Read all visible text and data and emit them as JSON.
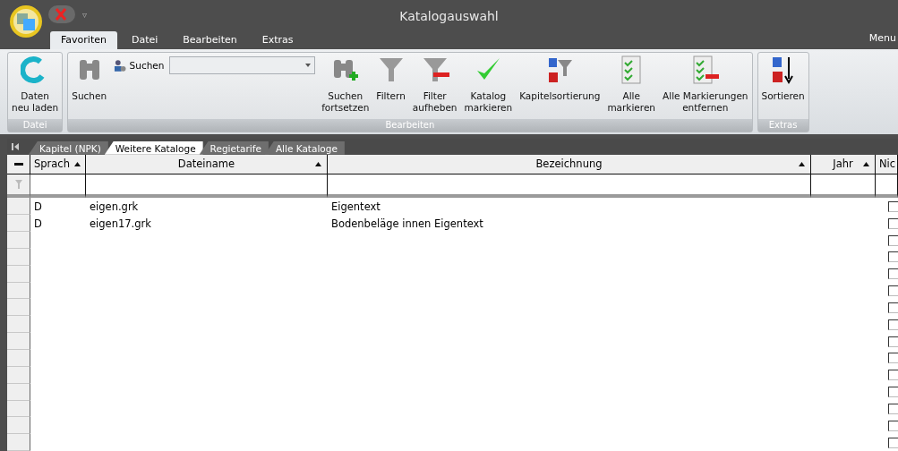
{
  "window": {
    "title": "Katalogauswahl"
  },
  "quick_access": {
    "dropdown": "▿"
  },
  "ribbon_tabs": [
    {
      "label": "Favoriten",
      "selected": true
    },
    {
      "label": "Datei",
      "selected": false
    },
    {
      "label": "Bearbeiten",
      "selected": false
    },
    {
      "label": "Extras",
      "selected": false
    }
  ],
  "menu": "Menu",
  "ribbon_groups": [
    {
      "title": "Datei",
      "items": [
        {
          "kind": "big",
          "label": "Daten\nneu laden"
        }
      ]
    },
    {
      "title": "Bearbeiten",
      "items": [
        {
          "kind": "big",
          "label": "Suchen"
        },
        {
          "kind": "search",
          "label": "Suchen"
        },
        {
          "kind": "big",
          "label": "Suchen\nfortsetzen"
        },
        {
          "kind": "big",
          "label": "Filtern"
        },
        {
          "kind": "big",
          "label": "Filter\naufheben"
        },
        {
          "kind": "big",
          "label": "Katalog\nmarkieren"
        },
        {
          "kind": "big",
          "label": "Kapitelsortierung"
        },
        {
          "kind": "big",
          "label": "Alle\nmarkieren"
        },
        {
          "kind": "big",
          "label": "Alle Markierungen\nentfernen"
        }
      ]
    },
    {
      "title": "Extras",
      "items": [
        {
          "kind": "big",
          "label": "Sortieren"
        }
      ]
    }
  ],
  "catalog_tabs": [
    {
      "label": "Kapitel (NPK)",
      "selected": false
    },
    {
      "label": "Weitere Kataloge",
      "selected": true
    },
    {
      "label": "Regietarife",
      "selected": false
    },
    {
      "label": "Alle Kataloge",
      "selected": false
    }
  ],
  "table": {
    "columns": [
      {
        "label": "Sprach",
        "sort": true
      },
      {
        "label": "Dateiname",
        "sort": true
      },
      {
        "label": "Bezeichnung",
        "sort": true
      },
      {
        "label": "Jahr",
        "sort": true
      },
      {
        "label": "Nic",
        "sort": false
      }
    ],
    "rows": [
      {
        "cells": [
          "D",
          "eigen.grk",
          "Eigentext"
        ],
        "checked": false
      },
      {
        "cells": [
          "D",
          "eigen17.grk",
          "Bodenbeläge innen Eigentext"
        ],
        "checked": false
      },
      {
        "checked": false
      },
      {
        "checked": false
      },
      {
        "checked": false
      },
      {
        "checked": false
      },
      {
        "checked": false
      },
      {
        "checked": false
      },
      {
        "checked": false
      },
      {
        "checked": false
      },
      {
        "checked": false
      },
      {
        "checked": false
      },
      {
        "checked": false
      },
      {
        "checked": false
      },
      {
        "checked": false
      }
    ]
  }
}
